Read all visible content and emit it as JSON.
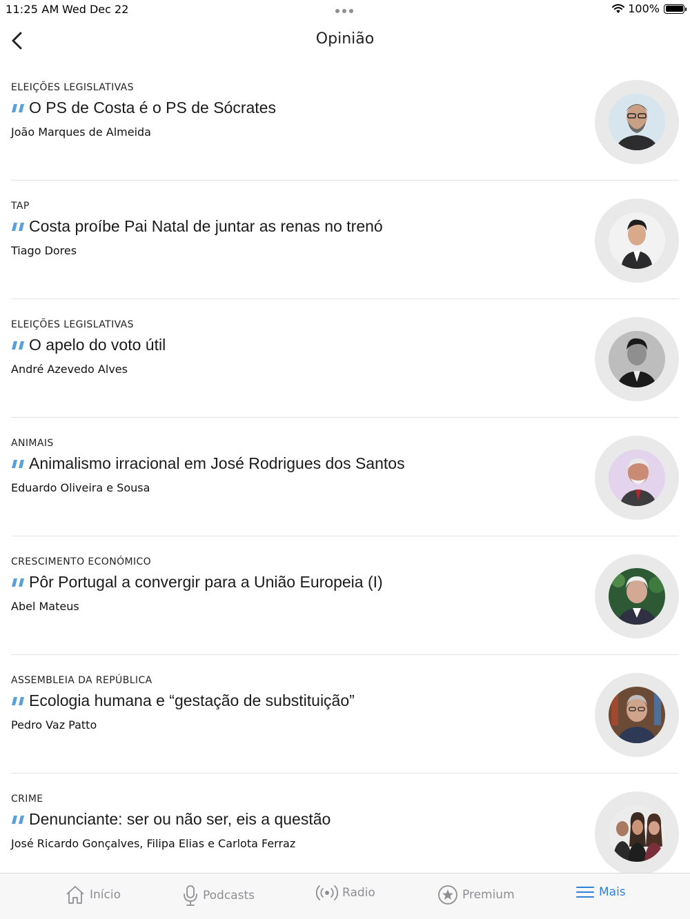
{
  "status_bar": {
    "time": "11:25 AM",
    "date": "Wed Dec 22",
    "battery": "100%"
  },
  "nav": {
    "title": "Opinião"
  },
  "articles": [
    {
      "category": "ELEIÇÕES LEGISLATIVAS",
      "headline": "O PS de Costa é o PS de Sócrates",
      "author": "João Marques de Almeida"
    },
    {
      "category": "TAP",
      "headline": "Costa proíbe Pai Natal de juntar as renas no trenó",
      "author": "Tiago Dores"
    },
    {
      "category": "ELEIÇÕES LEGISLATIVAS",
      "headline": "O apelo do voto útil",
      "author": "André Azevedo Alves"
    },
    {
      "category": "ANIMAIS",
      "headline": "Animalismo irracional em José Rodrigues dos Santos",
      "author": "Eduardo Oliveira e Sousa"
    },
    {
      "category": "CRESCIMENTO ECONÓMICO",
      "headline": "Pôr Portugal a convergir para a União Europeia (I)",
      "author": "Abel Mateus"
    },
    {
      "category": "ASSEMBLEIA DA REPÚBLICA",
      "headline": "Ecologia humana e “gestação de substituição”",
      "author": "Pedro Vaz Patto"
    },
    {
      "category": "CRIME",
      "headline": "Denunciante: ser ou não ser, eis a questão",
      "author": "José Ricardo Gonçalves, Filipa Elias e Carlota Ferraz"
    }
  ],
  "tab_bar": {
    "tabs": [
      {
        "label": "Início",
        "icon": "home-icon"
      },
      {
        "label": "Podcasts",
        "icon": "microphone-icon"
      },
      {
        "label": "Radio",
        "icon": "radio-icon"
      },
      {
        "label": "Premium",
        "icon": "star-icon"
      },
      {
        "label": "Mais",
        "icon": "menu-icon"
      }
    ],
    "active": "Mais"
  },
  "colors": {
    "accent": "#2f80d8",
    "quote": "#5aa0d8",
    "inactive": "#8e8e93"
  }
}
